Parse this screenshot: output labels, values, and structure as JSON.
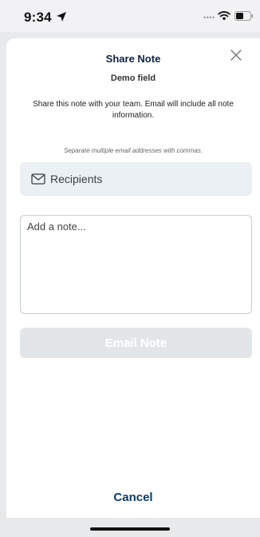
{
  "status_bar": {
    "time": "9:34",
    "signal": "••••"
  },
  "sheet": {
    "title": "Share Note",
    "subtitle": "Demo field",
    "description": "Share this note with your team. Email will include all note information.",
    "hint": "Separate multiple email addresses with commas.",
    "recipients": {
      "placeholder": "Recipients",
      "value": ""
    },
    "note": {
      "placeholder": "Add a note...",
      "value": ""
    },
    "email_button_label": "Email Note",
    "cancel_label": "Cancel"
  },
  "colors": {
    "title": "#0d2242",
    "cancel": "#0f3a6b",
    "recipients_bg": "#eaf0f4",
    "disabled_button": "#e3e6e9"
  },
  "icons": [
    "location-arrow-icon",
    "wifi-icon",
    "battery-icon",
    "close-icon",
    "mail-icon"
  ]
}
